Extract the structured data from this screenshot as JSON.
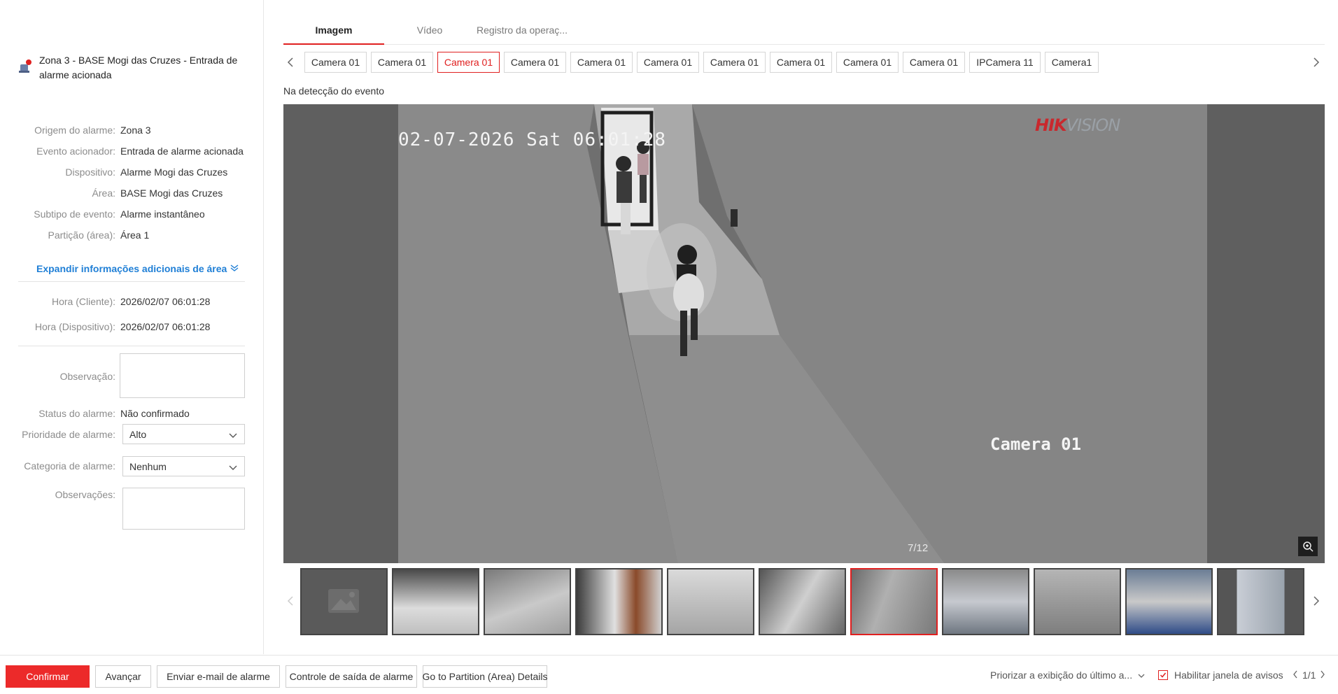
{
  "alarm": {
    "title": "Zona 3 - BASE Mogi das Cruzes - Entrada de alarme acionada"
  },
  "details": [
    {
      "label": "Origem do alarme:",
      "value": "Zona 3"
    },
    {
      "label": "Evento acionador:",
      "value": "Entrada de alarme acionada"
    },
    {
      "label": "Dispositivo:",
      "value": "Alarme Mogi das Cruzes"
    },
    {
      "label": "Área:",
      "value": "BASE Mogi das Cruzes"
    },
    {
      "label": "Subtipo de evento:",
      "value": "Alarme instantâneo"
    },
    {
      "label": "Partição (área):",
      "value": "Área 1"
    }
  ],
  "expand_link": "Expandir informações adicionais de área",
  "times": [
    {
      "label": "Hora (Cliente):",
      "value": "2026/02/07 06:01:28"
    },
    {
      "label": "Hora (Dispositivo):",
      "value": "2026/02/07 06:01:28"
    }
  ],
  "form": {
    "observation_label": "Observação:",
    "status_label": "Status do alarme:",
    "status_value": "Não confirmado",
    "priority_label": "Prioridade de alarme:",
    "priority_value": "Alto",
    "category_label": "Categoria de alarme:",
    "category_value": "Nenhum",
    "notes_label": "Observações:"
  },
  "tabs": [
    "Imagem",
    "Vídeo",
    "Registro da operaç..."
  ],
  "camera_tabs": [
    "Camera 01",
    "Camera 01",
    "Camera 01",
    "Camera 01",
    "Camera 01",
    "Camera 01",
    "Camera 01",
    "Camera 01",
    "Camera 01",
    "Camera 01",
    "IPCamera 11",
    "Camera1"
  ],
  "selected_camera_index": 2,
  "detect_label": "Na detecção do evento",
  "viewer": {
    "timestamp": "02-07-2026 Sat 06:01:28",
    "brand_left": "HIK",
    "brand_right": "VISION",
    "camera_overlay": "Camera 01",
    "counter": "7/12"
  },
  "thumbnails_count": 11,
  "active_thumbnail_index": 6,
  "bottom": {
    "confirm": "Confirmar",
    "next": "Avançar",
    "email": "Enviar e-mail de alarme",
    "output_control": "Controle de saída de alarme",
    "partition_details": "Go to Partition (Area) Details",
    "prioritize": "Priorizar a exibição do último a...",
    "enable_popup": "Habilitar janela de avisos",
    "page": "1/1"
  },
  "colors": {
    "accent": "#e02020",
    "link": "#1f7fd6",
    "primary_button": "#ec2a2a"
  }
}
